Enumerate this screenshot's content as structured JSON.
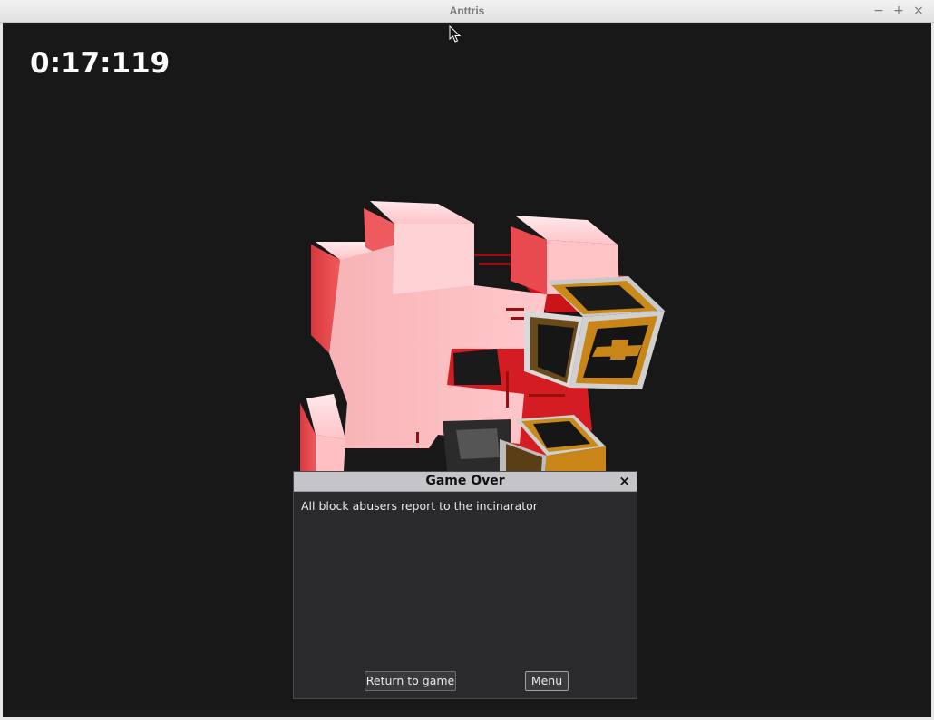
{
  "window": {
    "title": "Anttris",
    "minimize_glyph": "−",
    "maximize_glyph": "+",
    "close_glyph": "×"
  },
  "game": {
    "timer": "0:17:119"
  },
  "dialog": {
    "title": "Game Over",
    "close_glyph": "×",
    "message": "All block abusers report to the incinarator",
    "return_label": "Return to game",
    "menu_label": "Menu"
  }
}
